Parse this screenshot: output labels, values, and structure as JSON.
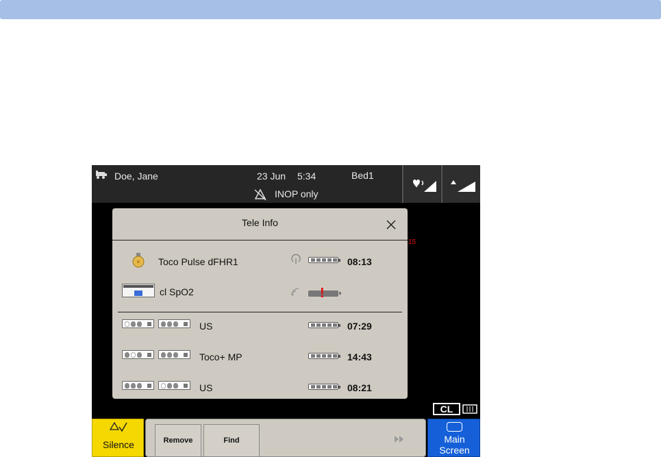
{
  "header": {
    "patient_name": "Doe,  Jane",
    "date": "23  Jun",
    "time": "5:34",
    "bed": "Bed1",
    "alarm_status": "INOP  only"
  },
  "dialog": {
    "title": "Tele  Info",
    "side_marker": "15",
    "rows": [
      {
        "label": "Toco Pulse dFHR1",
        "time": "08:13",
        "battery_level": 1.0
      },
      {
        "label": "cl SpO2",
        "time": "",
        "battery_level": 0.4
      },
      {
        "label": "US",
        "time": "07:29",
        "battery_level": 1.0
      },
      {
        "label": "Toco+  MP",
        "time": "14:43",
        "battery_level": 1.0
      },
      {
        "label": "US",
        "time": "08:21",
        "battery_level": 1.0
      }
    ]
  },
  "status": {
    "cl_label": "CL"
  },
  "footer": {
    "silence_label": "Silence",
    "remove_label": "Remove",
    "find_label": "Find",
    "main_screen_line1": "Main",
    "main_screen_line2": "Screen"
  },
  "colors": {
    "top_bar": "#a5bfe6",
    "silence_yellow": "#f5d800",
    "main_screen_blue": "#1560d8",
    "alert_red": "#e01010"
  }
}
